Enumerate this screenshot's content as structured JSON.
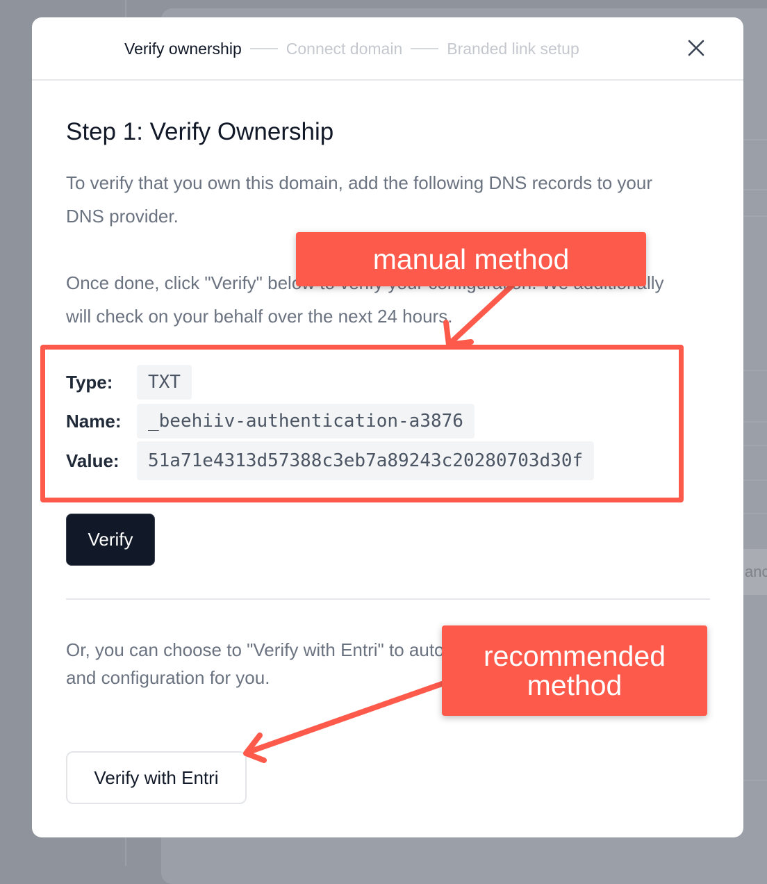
{
  "stepper": {
    "steps": [
      {
        "label": "Verify ownership",
        "state": "active"
      },
      {
        "label": "Connect domain",
        "state": "upcoming"
      },
      {
        "label": "Branded link setup",
        "state": "upcoming"
      }
    ]
  },
  "background": {
    "partial_text": "anc"
  },
  "content": {
    "title": "Step 1: Verify Ownership",
    "intro": "To verify that you own this domain, add the following DNS records to your DNS provider.",
    "once_done": "Once done, click \"Verify\" below to verify your configuration. We additionally will check on your behalf over the next 24 hours.",
    "dns": {
      "type_label": "Type:",
      "type_value": "TXT",
      "name_label": "Name:",
      "name_value": "_beehiiv-authentication-a3876",
      "value_label": "Value:",
      "value_value": "51a71e4313d57388c3eb7a89243c20280703d30f"
    },
    "verify_label": "Verify",
    "entri_text": "Or, you can choose to \"Verify with Entri\" to automatically verify the ownership and configuration for you.",
    "entri_label": "Verify with Entri"
  },
  "annotations": {
    "manual": "manual method",
    "recommended": "recommended method"
  },
  "colors": {
    "annotation": "#fe5a4c",
    "primary_button": "#111827",
    "overlay": "#8f939c"
  },
  "icons": {
    "close": "close-icon"
  }
}
